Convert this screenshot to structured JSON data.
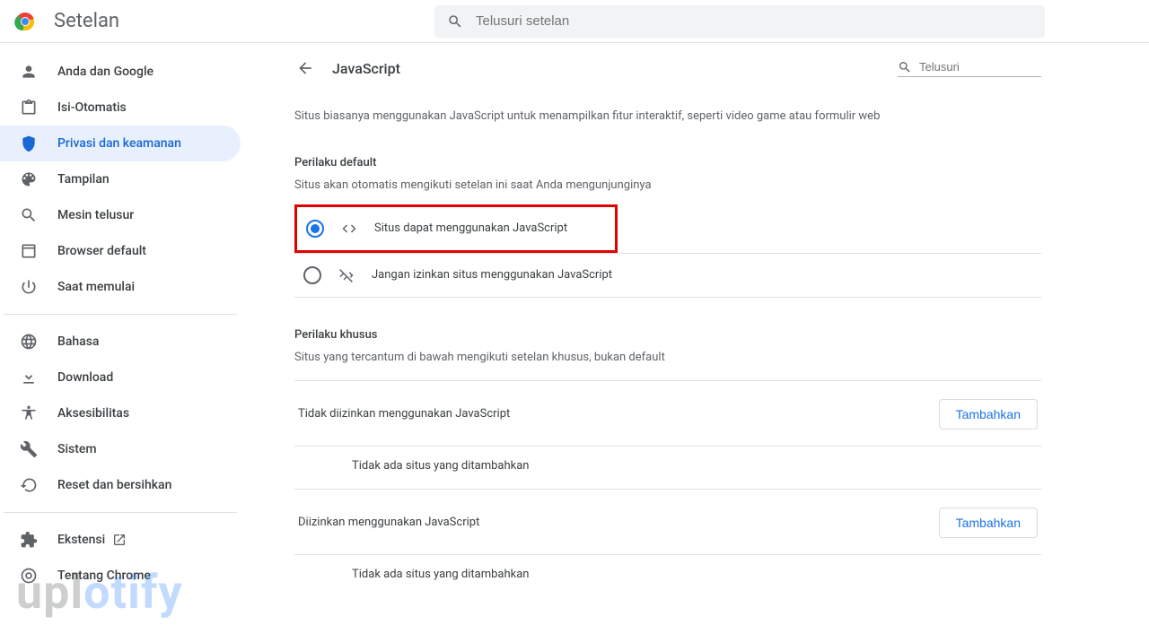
{
  "header": {
    "app_title": "Setelan",
    "search_placeholder": "Telusuri setelan"
  },
  "sidebar": {
    "groups": [
      [
        {
          "id": "you-google",
          "icon": "person",
          "label": "Anda dan Google"
        },
        {
          "id": "autofill",
          "icon": "clipboard",
          "label": "Isi-Otomatis"
        },
        {
          "id": "privacy",
          "icon": "shield",
          "label": "Privasi dan keamanan",
          "active": true
        },
        {
          "id": "appearance",
          "icon": "palette",
          "label": "Tampilan"
        },
        {
          "id": "search-engine",
          "icon": "search",
          "label": "Mesin telusur"
        },
        {
          "id": "default-browser",
          "icon": "browser",
          "label": "Browser default"
        },
        {
          "id": "startup",
          "icon": "power",
          "label": "Saat memulai"
        }
      ],
      [
        {
          "id": "languages",
          "icon": "globe",
          "label": "Bahasa"
        },
        {
          "id": "downloads",
          "icon": "download",
          "label": "Download"
        },
        {
          "id": "accessibility",
          "icon": "accessibility",
          "label": "Aksesibilitas"
        },
        {
          "id": "system",
          "icon": "wrench",
          "label": "Sistem"
        },
        {
          "id": "reset",
          "icon": "restore",
          "label": "Reset dan bersihkan"
        }
      ],
      [
        {
          "id": "extensions",
          "icon": "puzzle",
          "label": "Ekstensi",
          "external": true
        },
        {
          "id": "about",
          "icon": "chrome-outline",
          "label": "Tentang Chrome"
        }
      ]
    ]
  },
  "main": {
    "subtitle": "JavaScript",
    "mini_search_placeholder": "Telusuri",
    "description": "Situs biasanya menggunakan JavaScript untuk menampilkan fitur interaktif, seperti video game atau formulir web",
    "default_section_title": "Perilaku default",
    "default_section_sub": "Situs akan otomatis mengikuti setelan ini saat Anda mengunjunginya",
    "options": [
      {
        "id": "allow",
        "label": "Situs dapat menggunakan JavaScript",
        "icon": "code",
        "checked": true,
        "highlighted": true
      },
      {
        "id": "block",
        "label": "Jangan izinkan situs menggunakan JavaScript",
        "icon": "code-off",
        "checked": false
      }
    ],
    "custom_section_title": "Perilaku khusus",
    "custom_section_sub": "Situs yang tercantum di bawah mengikuti setelan khusus, bukan default",
    "rules": [
      {
        "id": "blocked",
        "title": "Tidak diizinkan menggunakan JavaScript",
        "empty": "Tidak ada situs yang ditambahkan",
        "button": "Tambahkan"
      },
      {
        "id": "allowed",
        "title": "Diizinkan menggunakan JavaScript",
        "empty": "Tidak ada situs yang ditambahkan",
        "button": "Tambahkan"
      }
    ]
  },
  "watermark": {
    "pre": "upl",
    "mid": "o",
    "post": "tify"
  }
}
